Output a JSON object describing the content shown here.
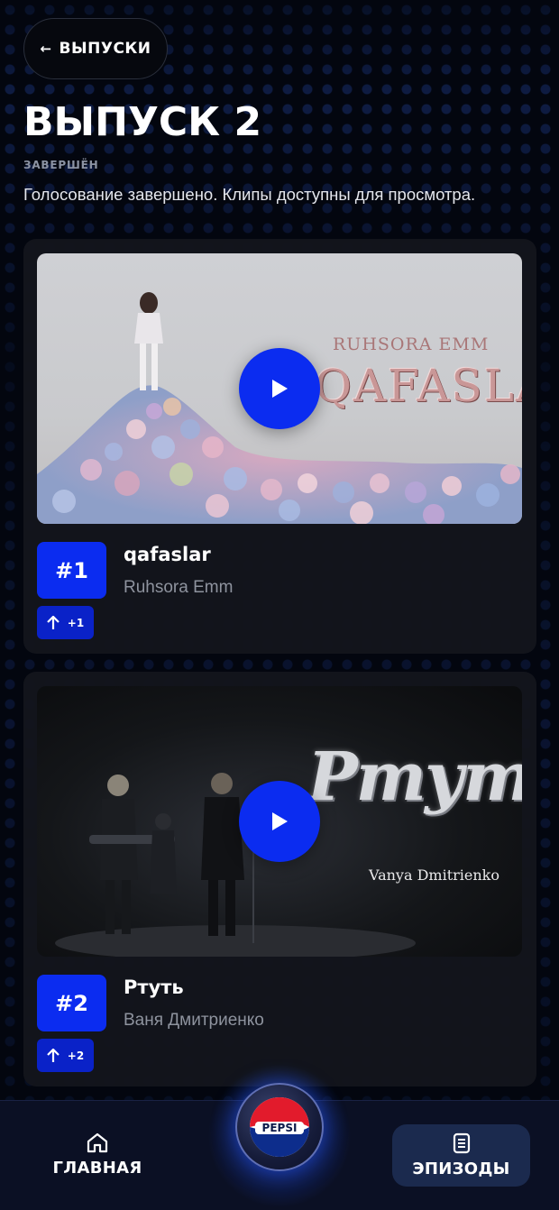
{
  "header": {
    "back_label": "ВЫПУСКИ",
    "title": "ВЫПУСК 2",
    "status": "ЗАВЕРШЁН",
    "description": "Голосование завершено. Клипы доступны для просмотра."
  },
  "tracks": [
    {
      "rank": "#1",
      "delta": "+1",
      "title": "qafaslar",
      "artist": "Ruhsora Emm",
      "thumbnail_text": [
        "RUHSORA EMM",
        "QAFASLAR"
      ]
    },
    {
      "rank": "#2",
      "delta": "+2",
      "title": "Ртуть",
      "artist": "Ваня Дмитриенко",
      "thumbnail_text": [
        "Ртуть",
        "Vanya Dmitrienko"
      ]
    }
  ],
  "bottom_nav": {
    "home_label": "ГЛАВНАЯ",
    "center_logo": "PEPSI",
    "episodes_label": "ЭПИЗОДЫ"
  },
  "colors": {
    "accent_blue": "#0b2cf0",
    "background": "#03060f",
    "card": "#13151c",
    "nav_bg": "#0b1024",
    "episodes_active": "#1b2a4e"
  },
  "icons": [
    "arrow-left-icon",
    "play-icon",
    "arrow-up-icon",
    "home-icon",
    "document-icon",
    "pepsi-logo"
  ]
}
